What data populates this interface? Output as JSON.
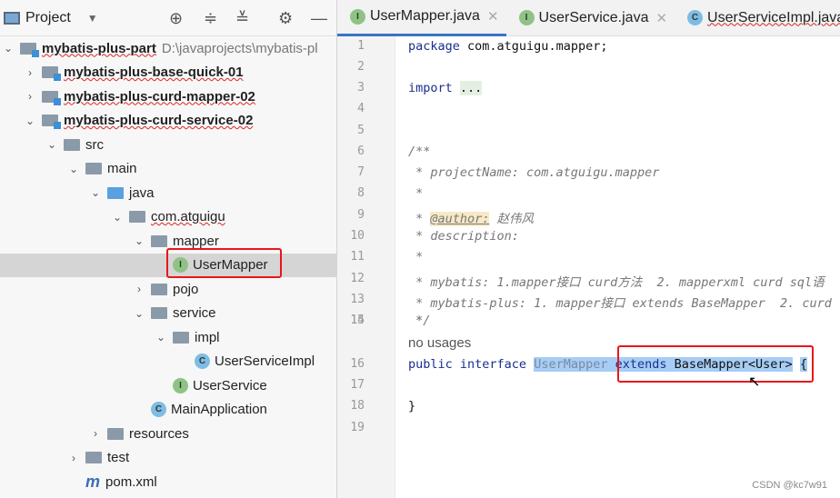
{
  "project_panel": {
    "title": "Project",
    "tools": [
      "locate-icon",
      "expand-all-icon",
      "collapse-all-icon",
      "gear-icon",
      "minimize-icon"
    ],
    "tree": [
      {
        "label": "mybatis-plus-part",
        "path": "D:\\javaprojects\\mybatis-pl",
        "depth": 0,
        "arrow": "down",
        "icon": "module",
        "bold": true
      },
      {
        "label": "mybatis-plus-base-quick-01",
        "depth": 1,
        "arrow": "right",
        "icon": "module",
        "bold": true
      },
      {
        "label": "mybatis-plus-curd-mapper-02",
        "depth": 1,
        "arrow": "right",
        "icon": "module",
        "bold": true
      },
      {
        "label": "mybatis-plus-curd-service-02",
        "depth": 1,
        "arrow": "down",
        "icon": "module",
        "bold": true
      },
      {
        "label": "src",
        "depth": 2,
        "arrow": "down",
        "icon": "folder"
      },
      {
        "label": "main",
        "depth": 3,
        "arrow": "down",
        "icon": "folder"
      },
      {
        "label": "java",
        "depth": 4,
        "arrow": "down",
        "icon": "java"
      },
      {
        "label": "com.atguigu",
        "depth": 5,
        "arrow": "down",
        "icon": "package"
      },
      {
        "label": "mapper",
        "depth": 6,
        "arrow": "down",
        "icon": "package"
      },
      {
        "label": "UserMapper",
        "depth": 7,
        "arrow": "",
        "icon": "I",
        "selected": true
      },
      {
        "label": "pojo",
        "depth": 6,
        "arrow": "right",
        "icon": "package"
      },
      {
        "label": "service",
        "depth": 6,
        "arrow": "down",
        "icon": "package"
      },
      {
        "label": "impl",
        "depth": 7,
        "arrow": "down",
        "icon": "package"
      },
      {
        "label": "UserServiceImpl",
        "depth": 8,
        "arrow": "",
        "icon": "C"
      },
      {
        "label": "UserService",
        "depth": 7,
        "arrow": "",
        "icon": "I"
      },
      {
        "label": "MainApplication",
        "depth": 6,
        "arrow": "",
        "icon": "C"
      },
      {
        "label": "resources",
        "depth": 4,
        "arrow": "right",
        "icon": "folder"
      },
      {
        "label": "test",
        "depth": 3,
        "arrow": "right",
        "icon": "folder"
      },
      {
        "label": "pom.xml",
        "depth": 3,
        "arrow": "",
        "icon": "m"
      }
    ]
  },
  "tabs": [
    {
      "label": "UserMapper.java",
      "icon": "I",
      "active": true
    },
    {
      "label": "UserService.java",
      "icon": "I"
    },
    {
      "label": "UserServiceImpl.java",
      "icon": "C"
    }
  ],
  "editor": {
    "lines": [
      {
        "n": "1",
        "text": "package com.atguigu.mapper;"
      },
      {
        "n": "2",
        "text": ""
      },
      {
        "n": "3",
        "text": "import ..."
      },
      {
        "n": "4",
        "text": ""
      },
      {
        "n": "5",
        "text": ""
      },
      {
        "n": "6",
        "text": "/**"
      },
      {
        "n": "7",
        "text": " * projectName: com.atguigu.mapper"
      },
      {
        "n": "8",
        "text": " *"
      },
      {
        "n": "9",
        "text": " * @author: 赵伟风"
      },
      {
        "n": "10",
        "text": " * description:"
      },
      {
        "n": "11",
        "text": " *"
      },
      {
        "n": "12",
        "text": " * mybatis: 1.mapper接口 curd方法  2. mapperxml curd sql语"
      },
      {
        "n": "13",
        "text": " * mybatis-plus: 1. mapper接口 extends BaseMapper  2. curd"
      },
      {
        "n": "14",
        "text": " *"
      },
      {
        "n": "15",
        "text": " */"
      },
      {
        "n": "",
        "text": "no usages"
      },
      {
        "n": "16",
        "text": "public interface UserMapper extends BaseMapper<User> {"
      },
      {
        "n": "17",
        "text": ""
      },
      {
        "n": "18",
        "text": "}"
      },
      {
        "n": "19",
        "text": ""
      }
    ]
  },
  "watermark": "CSDN @kc7w91"
}
